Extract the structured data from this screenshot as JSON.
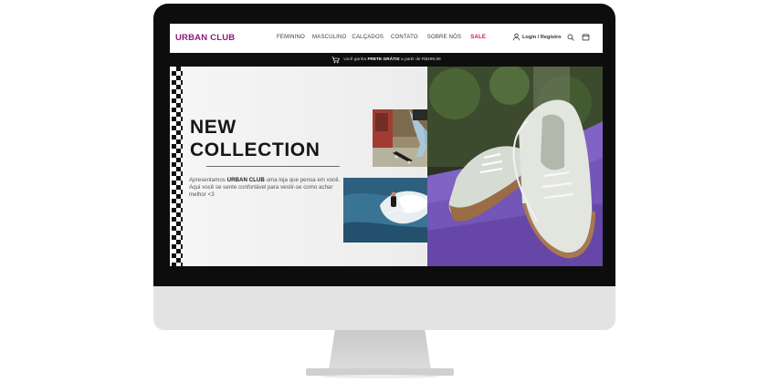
{
  "brand": {
    "name": "URBAN CLUB",
    "color": "#8a1a7e"
  },
  "nav": {
    "items": [
      {
        "label": "FEMININO"
      },
      {
        "label": "MASCULINO"
      },
      {
        "label": "CALÇADOS"
      },
      {
        "label": "CONTATO"
      },
      {
        "label": "SOBRE NÓS"
      },
      {
        "label": "SALE"
      }
    ],
    "login_label": "Login / Registro"
  },
  "shipping_bar": {
    "prefix": "você ganha ",
    "highlight": "FRETE GRÁTIS",
    "suffix": " a partir de R$499,99"
  },
  "hero": {
    "title_line1": "NEW",
    "title_line2": "COLLECTION",
    "desc_prefix": "Apresentamos ",
    "desc_brand": "URBAN CLUB",
    "desc_suffix": " uma loja que pensa em você. Aqui você se sente confortável para vestir-se como achar melhor <3"
  },
  "icons": [
    "user-icon",
    "search-icon",
    "cart-icon",
    "truck-icon",
    "checker-pattern"
  ],
  "colors": {
    "accent": "#8a1a7e",
    "sale": "#d2124f",
    "dark": "#0e0e0e",
    "purple_bg": "#7f5fc6"
  }
}
